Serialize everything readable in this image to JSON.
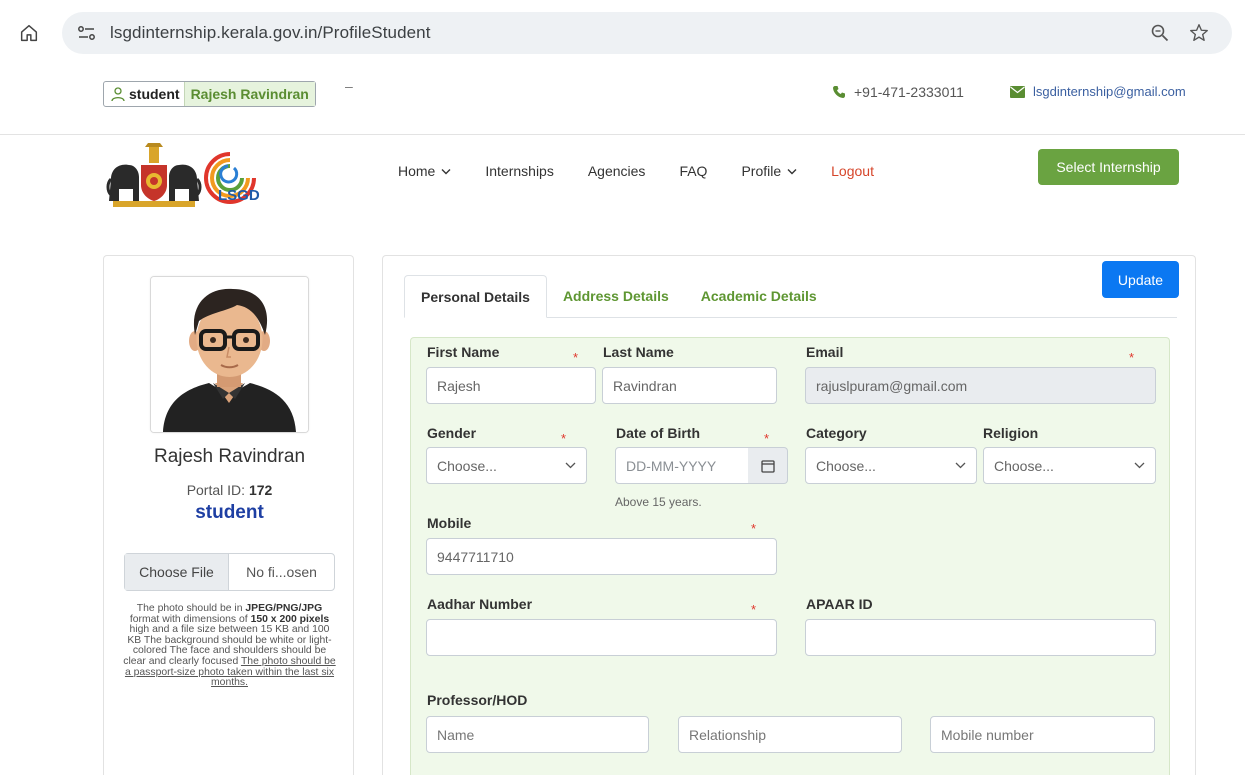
{
  "browser": {
    "url": "lsgdinternship.kerala.gov.in/ProfileStudent"
  },
  "topbar": {
    "role": "student",
    "user_name": "Rajesh Ravindran",
    "dash": "–",
    "phone": "+91-471-2333011",
    "email": "lsgdinternship@gmail.com"
  },
  "nav": {
    "logo_text": "LSGD",
    "items": [
      {
        "label": "Home",
        "dropdown": true
      },
      {
        "label": "Internships",
        "dropdown": false
      },
      {
        "label": "Agencies",
        "dropdown": false
      },
      {
        "label": "FAQ",
        "dropdown": false
      },
      {
        "label": "Profile",
        "dropdown": true
      },
      {
        "label": "Logout",
        "dropdown": false
      }
    ],
    "select_internship": "Select Internship"
  },
  "sidebar": {
    "name": "Rajesh Ravindran",
    "portal_label": "Portal ID: ",
    "portal_id": "172",
    "role": "student",
    "file_button": "Choose File",
    "file_status": "No fi...osen",
    "note": {
      "p1": "The photo should be in ",
      "fmt": "JPEG/PNG/JPG",
      "p2": " format with dimensions of ",
      "dims": "150 x 200 pixels",
      "p3": " high and a file size between 15 KB and 100 KB The background should be white or light-colored The face and shoulders should be clear and clearly focused ",
      "p4": "The photo should be a passport-size photo taken within the last six months."
    }
  },
  "main": {
    "update_button": "Update",
    "tabs": [
      {
        "label": "Personal Details",
        "active": true
      },
      {
        "label": "Address Details",
        "active": false
      },
      {
        "label": "Academic Details",
        "active": false
      }
    ],
    "form": {
      "required_mark": "*",
      "first_name": {
        "label": "First Name",
        "value": "Rajesh"
      },
      "last_name": {
        "label": "Last Name",
        "value": "Ravindran"
      },
      "email": {
        "label": "Email",
        "value": "rajuslpuram@gmail.com"
      },
      "gender": {
        "label": "Gender",
        "value": "Choose..."
      },
      "dob": {
        "label": "Date of Birth",
        "placeholder": "DD-MM-YYYY",
        "hint": "Above 15 years."
      },
      "category": {
        "label": "Category",
        "value": "Choose..."
      },
      "religion": {
        "label": "Religion",
        "value": "Choose..."
      },
      "mobile": {
        "label": "Mobile",
        "value": "9447711710"
      },
      "aadhar": {
        "label": "Aadhar Number",
        "value": ""
      },
      "apaar": {
        "label": "APAAR ID",
        "value": ""
      },
      "professor": {
        "label": "Professor/HOD",
        "name_placeholder": "Name",
        "relationship_placeholder": "Relationship",
        "mobile_placeholder": "Mobile number"
      }
    }
  },
  "colors": {
    "brand_green": "#6aa341",
    "update_blue": "#0b78f2",
    "logout_red": "#d6452a",
    "role_blue": "#1e3fa3",
    "panel_bg": "#f0f9ea"
  }
}
